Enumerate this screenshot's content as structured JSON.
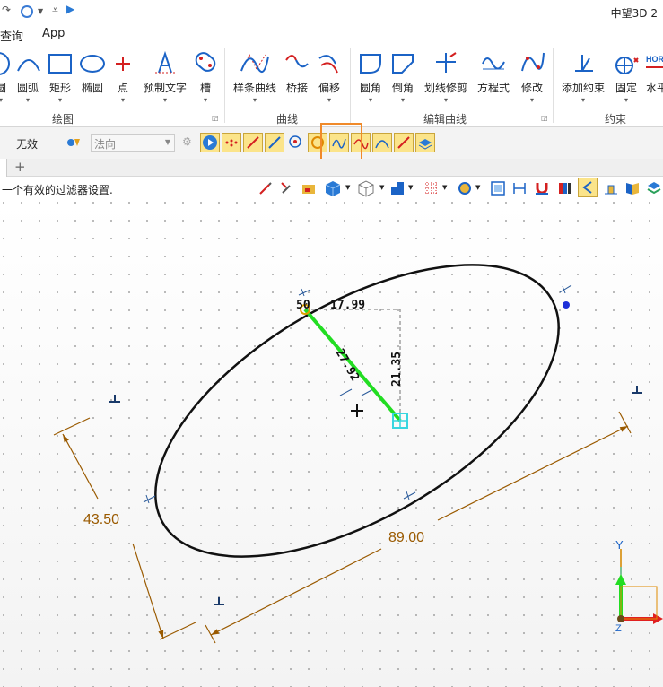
{
  "app": {
    "title": "中望3D 2"
  },
  "menu": {
    "items": [
      "查询",
      "App"
    ]
  },
  "ribbon": {
    "buttons": [
      {
        "label": "圆",
        "icon": "circle-icon"
      },
      {
        "label": "圆弧",
        "icon": "arc-icon"
      },
      {
        "label": "矩形",
        "icon": "rectangle-icon"
      },
      {
        "label": "椭圆",
        "icon": "ellipse-icon"
      },
      {
        "label": "点",
        "icon": "point-icon"
      },
      {
        "label": "预制文字",
        "icon": "text-icon"
      },
      {
        "label": "槽",
        "icon": "slot-icon"
      },
      {
        "label": "样条曲线",
        "icon": "spline-icon"
      },
      {
        "label": "桥接",
        "icon": "bridge-icon"
      },
      {
        "label": "偏移",
        "icon": "offset-icon"
      },
      {
        "label": "圆角",
        "icon": "fillet-icon"
      },
      {
        "label": "倒角",
        "icon": "chamfer-icon"
      },
      {
        "label": "划线修剪",
        "icon": "trim-icon"
      },
      {
        "label": "方程式",
        "icon": "equation-icon"
      },
      {
        "label": "修改",
        "icon": "modify-icon"
      },
      {
        "label": "添加约束",
        "icon": "add-constraint-icon"
      },
      {
        "label": "固定",
        "icon": "fix-icon"
      },
      {
        "label": "水平",
        "icon": "horizontal-icon"
      }
    ],
    "groups": [
      "绘图",
      "曲线",
      "编辑曲线",
      "约束"
    ]
  },
  "filter": {
    "mode_label": "无效",
    "direction_placeholder": "法向"
  },
  "prompt": {
    "text": "一个有效的过滤器设置."
  },
  "sketch": {
    "dim_horizontal": "17.99",
    "dim_vertical": "21.35",
    "dim_aligned": "27.92",
    "dim_angle": "50",
    "dim_major": "89.00",
    "dim_minor": "43.50",
    "axis_y": "Y",
    "axis_z": "Z"
  },
  "colors": {
    "highlight": "#f08a2a",
    "dimension": "#9a5a00",
    "green_line": "#22dd22",
    "cyan_point": "#38d6e0",
    "blue_point": "#1d2fd8"
  }
}
